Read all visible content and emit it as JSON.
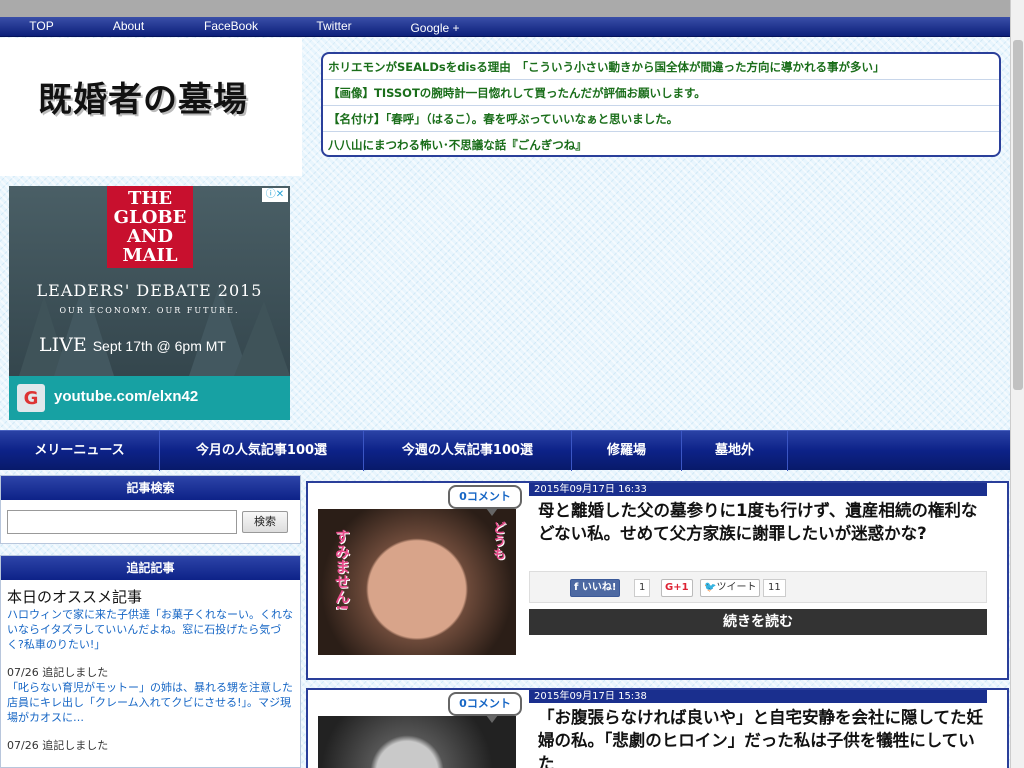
{
  "top_nav": {
    "items": [
      "TOP",
      "About",
      "FaceBook",
      "Twitter",
      "Google +"
    ]
  },
  "site": {
    "title": "既婚者の墓場"
  },
  "headlines": [
    "ホリエモンがSEALDsをdisる理由　「こういう小さい動きから国全体が間違った方向に導かれる事が多い」",
    "【画像】TISSOTの腕時計一目惚れして買ったんだが評価お願いします。",
    "【名付け】「春呼」（はるこ）。春を呼ぶっていいなぁと思いました。",
    "八八山にまつわる怖い･不思議な話『ごんぎつね』"
  ],
  "ad": {
    "brand": "THE GLOBE AND MAIL",
    "headline": "LEADERS' DEBATE 2015",
    "tagline": "OUR ECONOMY. OUR FUTURE.",
    "live_label": "LIVE",
    "live_time": "Sept 17th @ 6pm MT",
    "url": "youtube.com/elxn42",
    "adchoices_icon": "adchoices-icon"
  },
  "main_nav": {
    "items": [
      "メリーニュース",
      "今月の人気記事100選",
      "今週の人気記事100選",
      "修羅場",
      "墓地外"
    ]
  },
  "sidebar": {
    "search": {
      "header": "記事検索",
      "placeholder": "",
      "button": "検索"
    },
    "recent": {
      "header": "追記記事",
      "title": "本日のオススメ記事",
      "link1": "ハロウィンで家に来た子供達「お菓子くれなーい。くれないならイタズラしていいんだよね。窓に石投げたら気づく?私車のりたい!」",
      "date1": "07/26 追記しました",
      "link2": "「叱らない育児がモットー」の姉は、暴れる甥を注意した店員にキレ出し「クレーム入れてクビにさせる!」。マジ現場がカオスに…",
      "date2": "07/26 追記しました"
    }
  },
  "articles": [
    {
      "comments": "0コメント",
      "date": "2015年09月17日 16:33",
      "title": "母と離婚した父の墓参りに1度も行けず、遺産相続の権利などない私。せめて父方家族に謝罪したいが迷惑かな?",
      "like_label": "いいね!",
      "like_count": "1",
      "gplus_label": "G+1",
      "tweet_label": "ツイート",
      "tweet_count": "11",
      "read_more": "続きを読む",
      "thumb_text1": "すみません!",
      "thumb_text2": "どうも"
    },
    {
      "comments": "0コメント",
      "date": "2015年09月17日 15:38",
      "title": "「お腹張らなければ良いや」と自宅安静を会社に隠してた妊婦の私。「悲劇のヒロイン」だった私は子供を犠牲にしていた"
    }
  ]
}
